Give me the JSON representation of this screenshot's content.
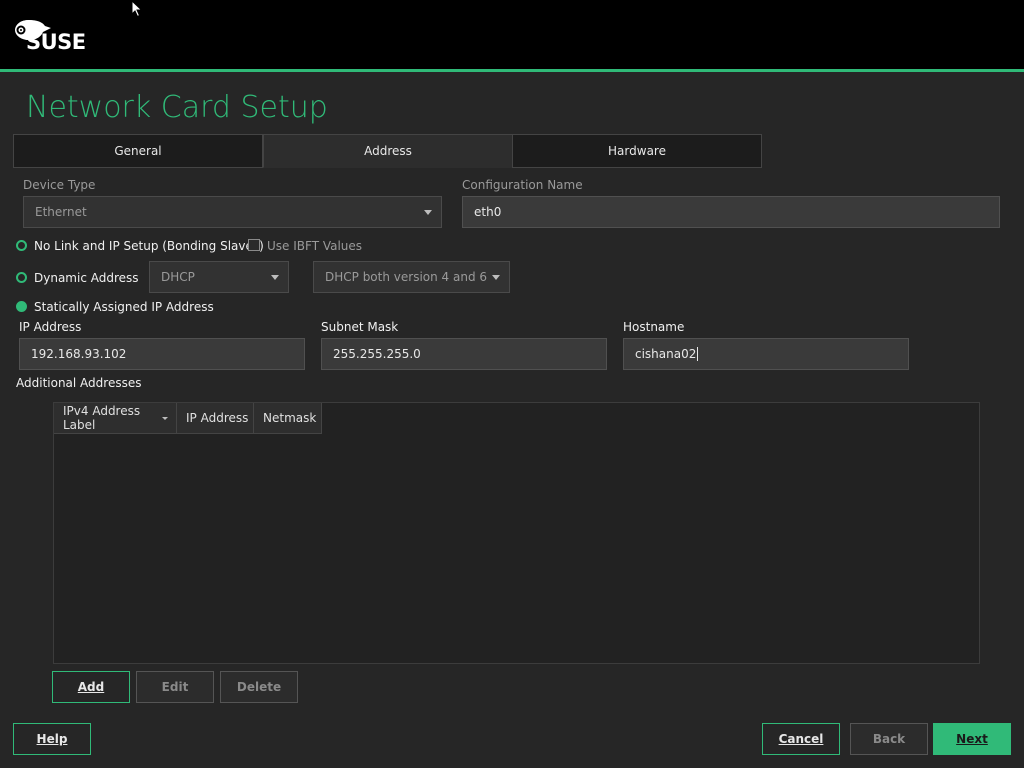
{
  "brand": {
    "logo_text": "SUSE",
    "accent": "#30ba78"
  },
  "page": {
    "title": "Network Card Setup"
  },
  "tabs": [
    {
      "label": "General",
      "active": false
    },
    {
      "label": "Address",
      "active": true
    },
    {
      "label": "Hardware",
      "active": false
    }
  ],
  "device_type": {
    "label": "Device Type",
    "value": "Ethernet"
  },
  "config_name": {
    "label": "Configuration Name",
    "value": "eth0"
  },
  "options": {
    "no_link": "No Link and IP Setup (Bonding Slaves)",
    "use_ibft": "Use IBFT Values",
    "dynamic": "Dynamic Address",
    "dynamic_method": "DHCP",
    "dhcp_version": "DHCP both version 4 and 6",
    "static": "Statically Assigned IP Address"
  },
  "ip": {
    "label": "IP Address",
    "value": "192.168.93.102"
  },
  "subnet": {
    "label": "Subnet Mask",
    "value": "255.255.255.0"
  },
  "hostname": {
    "label": "Hostname",
    "value": "cishana02"
  },
  "additional": {
    "label": "Additional Addresses",
    "columns": [
      "IPv4 Address Label",
      "IP Address",
      "Netmask"
    ]
  },
  "table_buttons": {
    "add": "Add",
    "edit": "Edit",
    "delete": "Delete"
  },
  "footer": {
    "help": "Help",
    "cancel": "Cancel",
    "back": "Back",
    "next": "Next"
  }
}
